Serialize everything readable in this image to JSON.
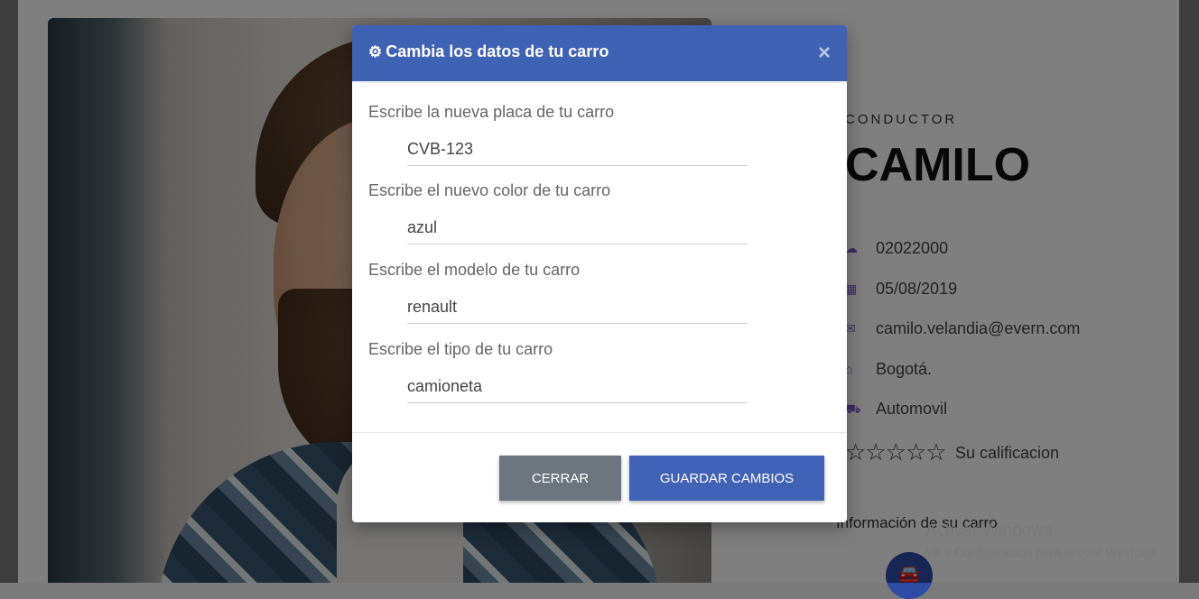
{
  "profile": {
    "role_label": "CONDUCTOR",
    "name": "CAMILO",
    "details": [
      {
        "icon": "cloud-icon",
        "text": "02022000"
      },
      {
        "icon": "calendar-icon",
        "text": "05/08/2019"
      },
      {
        "icon": "email-icon",
        "text": "camilo.velandia@evern.com"
      },
      {
        "icon": "home-icon",
        "text": "Bogotá."
      },
      {
        "icon": "car-icon",
        "text": "Automovil"
      }
    ],
    "rating_label": "Su calificacion",
    "rating_stars": 0,
    "car_info_title": "Información de su carro"
  },
  "modal": {
    "title": "Cambia los datos de tu carro",
    "close_symbol": "×",
    "fields": [
      {
        "label": "Escribe la nueva placa de tu carro",
        "value": "CVB-123"
      },
      {
        "label": "Escribe el nuevo color de tu carro",
        "value": "azul"
      },
      {
        "label": "Escribe el modelo de tu carro",
        "value": "renault"
      },
      {
        "label": "Escribe el tipo de tu carro",
        "value": "camioneta"
      }
    ],
    "buttons": {
      "close_label": "CERRAR",
      "save_label": "GUARDAR CAMBIOS"
    }
  },
  "watermark": {
    "line1": "Activar Windows",
    "line2": "Ve a Configuración para activar Windows."
  },
  "colors": {
    "header": "#3f63b4",
    "save_button": "#4062b7",
    "close_button": "#6c757d",
    "icon_accent": "#7c56c9"
  }
}
